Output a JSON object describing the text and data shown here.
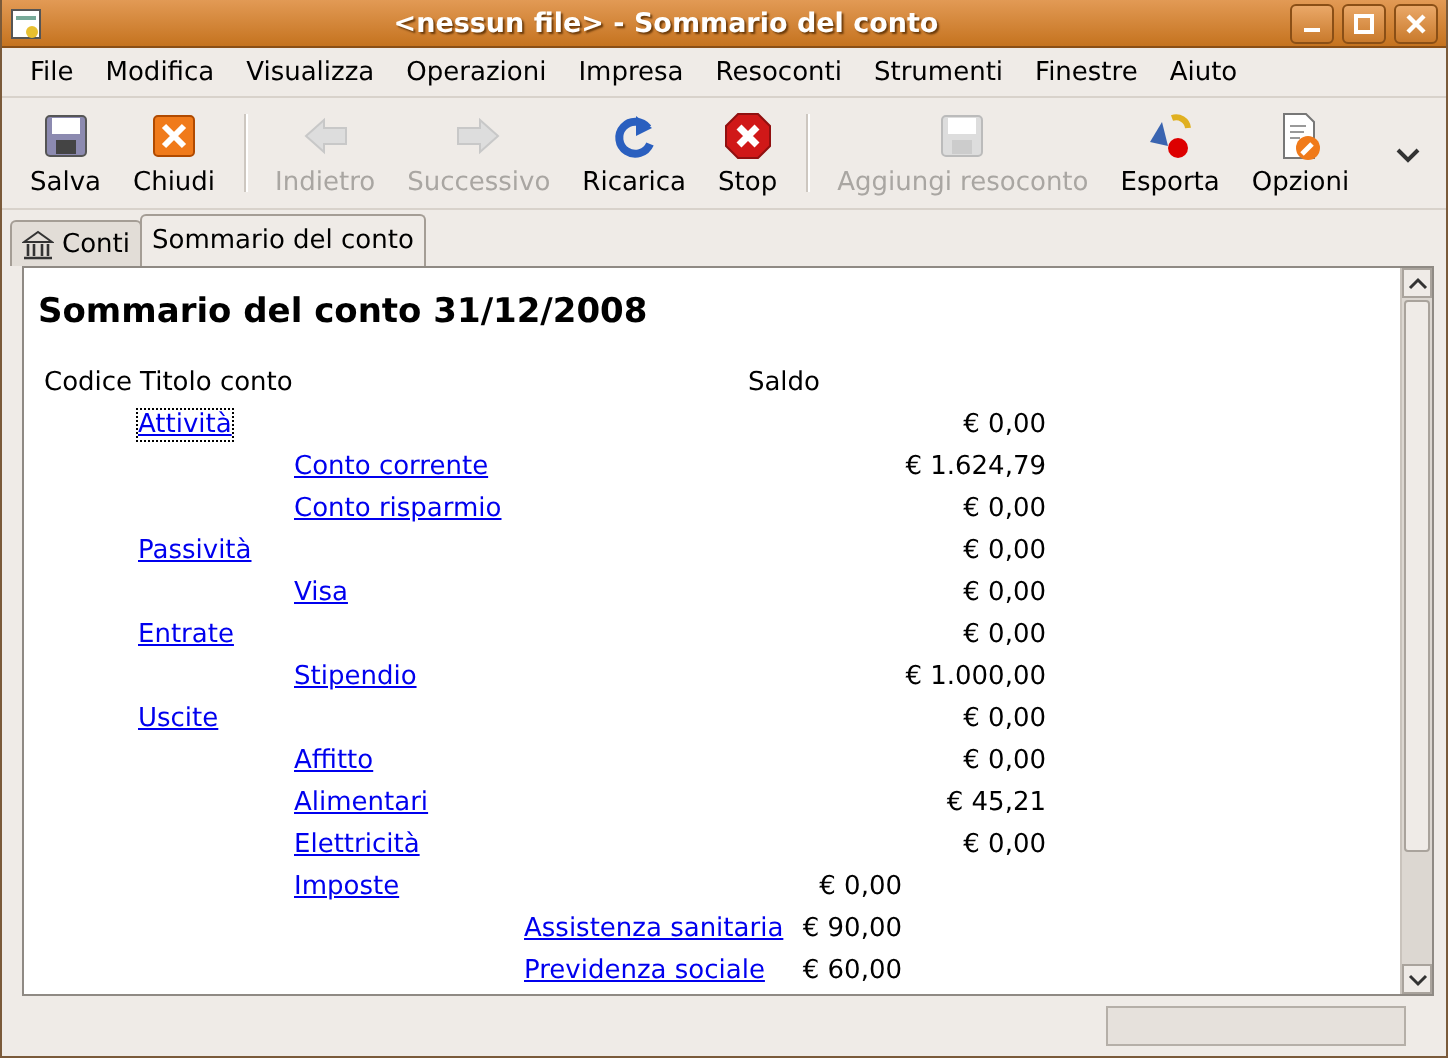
{
  "window": {
    "title": "<nessun file> - Sommario del conto"
  },
  "menu": [
    {
      "label": "File"
    },
    {
      "label": "Modifica"
    },
    {
      "label": "Visualizza"
    },
    {
      "label": "Operazioni"
    },
    {
      "label": "Impresa"
    },
    {
      "label": "Resoconti"
    },
    {
      "label": "Strumenti"
    },
    {
      "label": "Finestre"
    },
    {
      "label": "Aiuto"
    }
  ],
  "toolbar": [
    {
      "kind": "save",
      "label": "Salva",
      "disabled": false
    },
    {
      "kind": "close",
      "label": "Chiudi",
      "disabled": false
    },
    {
      "kind": "separator"
    },
    {
      "kind": "back",
      "label": "Indietro",
      "disabled": true
    },
    {
      "kind": "forward",
      "label": "Successivo",
      "disabled": true
    },
    {
      "kind": "reload",
      "label": "Ricarica",
      "disabled": false
    },
    {
      "kind": "stop",
      "label": "Stop",
      "disabled": false
    },
    {
      "kind": "separator"
    },
    {
      "kind": "save",
      "label": "Aggiungi resoconto",
      "disabled": true
    },
    {
      "kind": "export",
      "label": "Esporta",
      "disabled": false
    },
    {
      "kind": "options",
      "label": "Opzioni",
      "disabled": false
    }
  ],
  "tabs": [
    {
      "label": "Conti",
      "kind": "accounts",
      "selected": false
    },
    {
      "label": "Sommario del conto",
      "kind": "report",
      "selected": true
    }
  ],
  "report": {
    "title": "Sommario del conto 31/12/2008",
    "columns": [
      "Codice",
      "Titolo conto",
      "Saldo"
    ],
    "accounts": [
      {
        "name": "Attività",
        "balance": "€ 0,00",
        "focused": true,
        "children": [
          {
            "name": "Conto corrente",
            "balance": "€ 1.624,79",
            "focused": false
          },
          {
            "name": "Conto risparmio",
            "balance": "€ 0,00",
            "focused": false
          }
        ]
      },
      {
        "name": "Passività",
        "balance": "€ 0,00",
        "focused": false,
        "children": [
          {
            "name": "Visa",
            "balance": "€ 0,00",
            "focused": false
          }
        ]
      },
      {
        "name": "Entrate",
        "balance": "€ 0,00",
        "focused": false,
        "children": [
          {
            "name": "Stipendio",
            "balance": "€ 1.000,00",
            "focused": false
          }
        ]
      },
      {
        "name": "Uscite",
        "balance": "€ 0,00",
        "focused": false,
        "children": [
          {
            "name": "Affitto",
            "balance": "€ 0,00",
            "focused": false
          },
          {
            "name": "Alimentari",
            "balance": "€ 45,21",
            "focused": false
          },
          {
            "name": "Elettricità",
            "balance": "€ 0,00",
            "focused": false
          },
          {
            "name": "Imposte",
            "balance": "€ 0,00",
            "focused": false,
            "children": [
              {
                "name": "Assistenza sanitaria",
                "balance": "€ 90,00",
                "focused": false
              },
              {
                "name": "Previdenza sociale",
                "balance": "€ 60,00",
                "focused": false
              }
            ]
          }
        ]
      }
    ]
  }
}
